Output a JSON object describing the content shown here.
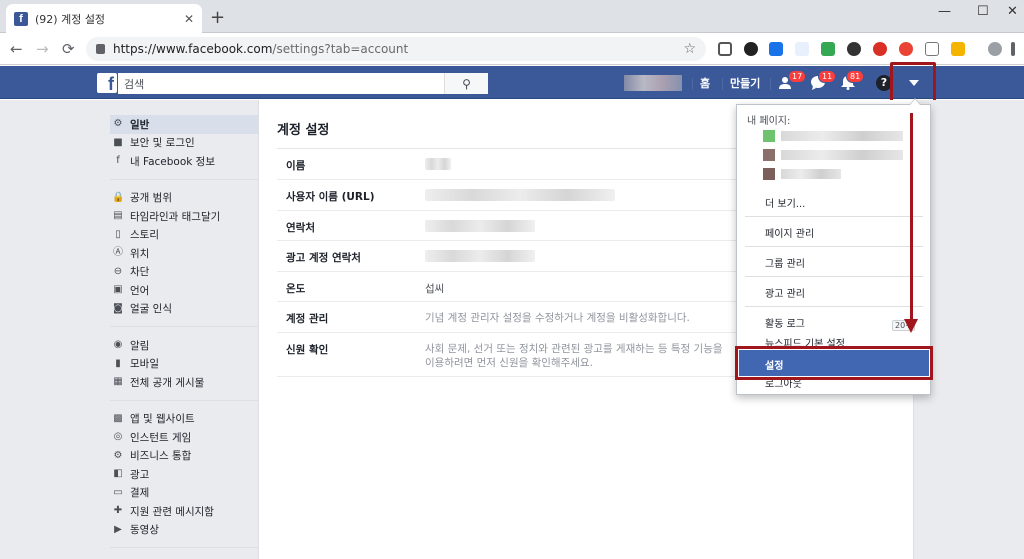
{
  "browser": {
    "tab_title": "(92) 계정 설정",
    "tab_close": "✕",
    "new_tab": "+",
    "window_controls": [
      "—",
      "☐",
      "✕"
    ],
    "url_base": "https://www.facebook.com",
    "url_path": "/settings?tab=account",
    "back": "←",
    "forward": "→",
    "reload": "⟳"
  },
  "fb_header": {
    "logo": "f",
    "search_placeholder": "검색",
    "search_icon": "⚲",
    "home": "홈",
    "create": "만들기",
    "badges": [
      "17",
      "11",
      "81"
    ],
    "help": "?"
  },
  "left_nav": {
    "groups": [
      [
        {
          "icon": "⚙",
          "label": "일반",
          "active": true
        },
        {
          "icon": "■",
          "label": "보안 및 로그인"
        },
        {
          "icon": "f",
          "label": "내 Facebook 정보"
        }
      ],
      [
        {
          "icon": "🔒",
          "label": "공개 범위"
        },
        {
          "icon": "▤",
          "label": "타임라인과 태그달기"
        },
        {
          "icon": "▯",
          "label": "스토리"
        },
        {
          "icon": "Ⓐ",
          "label": "위치"
        },
        {
          "icon": "⊖",
          "label": "차단"
        },
        {
          "icon": "▣",
          "label": "언어"
        },
        {
          "icon": "◙",
          "label": "얼굴 인식"
        }
      ],
      [
        {
          "icon": "◉",
          "label": "알림"
        },
        {
          "icon": "▮",
          "label": "모바일"
        },
        {
          "icon": "▦",
          "label": "전체 공개 게시물"
        }
      ],
      [
        {
          "icon": "▩",
          "label": "앱 및 웹사이트"
        },
        {
          "icon": "◎",
          "label": "인스턴트 게임"
        },
        {
          "icon": "⚙",
          "label": "비즈니스 통합"
        },
        {
          "icon": "◧",
          "label": "광고"
        },
        {
          "icon": "▭",
          "label": "결제"
        },
        {
          "icon": "✚",
          "label": "지원 관련 메시지함"
        },
        {
          "icon": "▶",
          "label": "동영상"
        }
      ]
    ]
  },
  "content": {
    "title": "계정 설정",
    "rows": [
      {
        "label": "이름",
        "value": ""
      },
      {
        "label": "사용자 이름 (URL)",
        "value": ""
      },
      {
        "label": "연락처",
        "value": ""
      },
      {
        "label": "광고 계정 연락처",
        "value": ""
      },
      {
        "label": "온도",
        "value": "섭씨"
      },
      {
        "label": "계정 관리",
        "value": "기념 계정 관리자 설정을 수정하거나 계정을 비활성화합니다."
      },
      {
        "label": "신원 확인",
        "value": "사회 문제, 선거 또는 정치와 관련된 광고를 게재하는 등 특정 기능을 이용하려면 먼저 신원을 확인해주세요."
      }
    ]
  },
  "dropdown": {
    "header": "내 페이지:",
    "more": "더 보기...",
    "items": [
      "페이지 관리",
      "그룹 관리",
      "광고 관리",
      "활동 로그",
      "뉴스피드 기본 설정",
      "설정",
      "로그아웃"
    ],
    "activity_count": "20+"
  },
  "colors": {
    "fb_blue": "#3b5998",
    "highlight_red": "#a1151c",
    "selected_blue": "#4267b2"
  }
}
